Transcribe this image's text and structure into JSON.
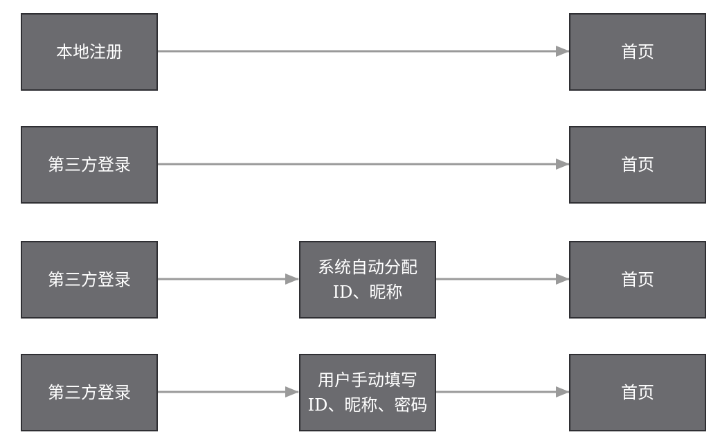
{
  "rows": [
    {
      "start": "本地注册",
      "middle": null,
      "end": "首页"
    },
    {
      "start": "第三方登录",
      "middle": null,
      "end": "首页"
    },
    {
      "start": "第三方登录",
      "middle": {
        "line1": "系统自动分配",
        "line2": "ID、昵称"
      },
      "end": "首页"
    },
    {
      "start": "第三方登录",
      "middle": {
        "line1": "用户手动填写",
        "line2": "ID、昵称、密码"
      },
      "end": "首页"
    }
  ],
  "colors": {
    "box_fill": "#6b6b6f",
    "box_border": "#2f2f33",
    "text": "#ffffff",
    "arrow": "#9a9a9a"
  }
}
